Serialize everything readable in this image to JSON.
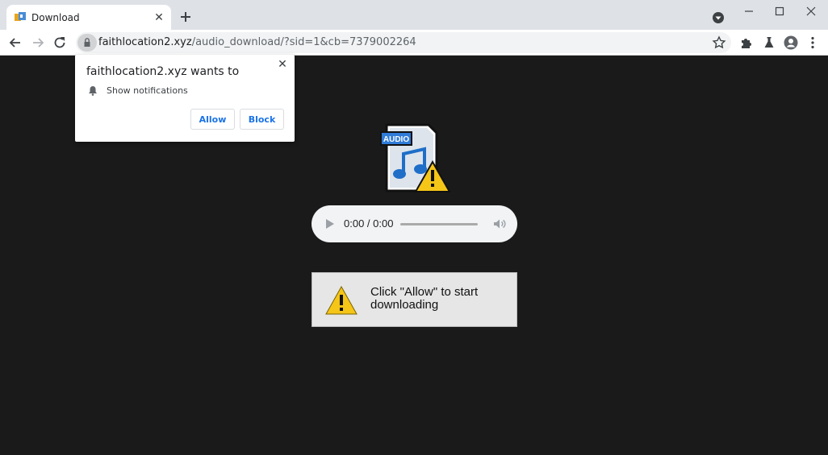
{
  "tab": {
    "title": "Download",
    "close": "✕"
  },
  "omnibox": {
    "domain": "faithlocation2.xyz",
    "path": "/audio_download/?sid=1&cb=7379002264"
  },
  "player": {
    "time": "0:00 / 0:00"
  },
  "file_icon": {
    "badge": "AUDIO"
  },
  "message": {
    "text": "Click \"Allow\" to start downloading"
  },
  "popup": {
    "title": "faithlocation2.xyz wants to",
    "permission": "Show notifications",
    "allow": "Allow",
    "block": "Block",
    "close": "✕"
  },
  "colors": {
    "accent": "#1a73e8",
    "background": "#1a1a1a",
    "warning": "#f5c518"
  },
  "icons": [
    "back-icon",
    "forward-icon",
    "reload-icon",
    "lock-icon",
    "star-icon",
    "extensions-icon",
    "labs-icon",
    "profile-icon",
    "menu-icon",
    "bell-icon",
    "play-icon",
    "volume-icon",
    "warning-icon"
  ]
}
